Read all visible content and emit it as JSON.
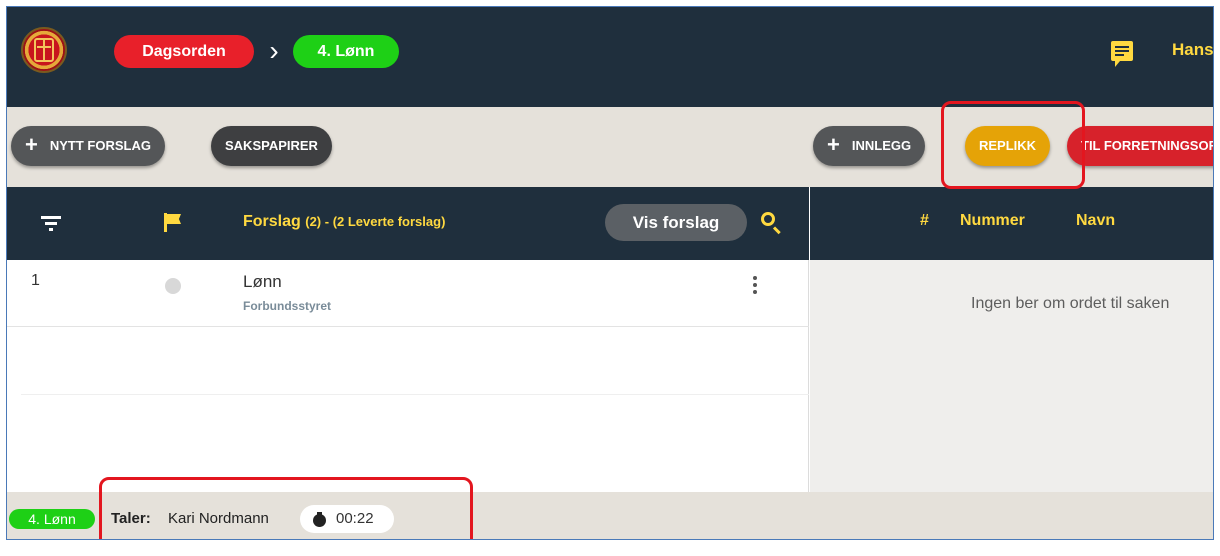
{
  "header": {
    "breadcrumb": [
      "Dagsorden",
      "4. Lønn"
    ],
    "separator": "›",
    "user_name": "Hans",
    "colors": {
      "background": "#1f2f3d",
      "accent": "#ffd940",
      "crumb_red": "#e8202a",
      "crumb_green": "#1ed016"
    }
  },
  "toolbar": {
    "new_proposal": "NYTT FORSLAG",
    "case_papers": "SAKSPAPIRER",
    "entry": "INNLEGG",
    "reply": "REPLIKK",
    "point_of_order": "TIL FORRETNINGSORDEN",
    "plus": "+"
  },
  "proposals": {
    "title": "Forslag",
    "subtitle": "(2) - (2 Leverte forslag)",
    "show_button": "Vis forslag",
    "rows": [
      {
        "number": "1",
        "title": "Lønn",
        "submitter": "Forbundsstyret"
      }
    ]
  },
  "speakers": {
    "columns": [
      "#",
      "Nummer",
      "Navn"
    ],
    "empty_message": "Ingen ber om ordet til saken"
  },
  "footer": {
    "current_item": "4. Lønn",
    "speaker_label": "Taler:",
    "speaker_name": "Kari Nordmann",
    "timer": "00:22"
  }
}
